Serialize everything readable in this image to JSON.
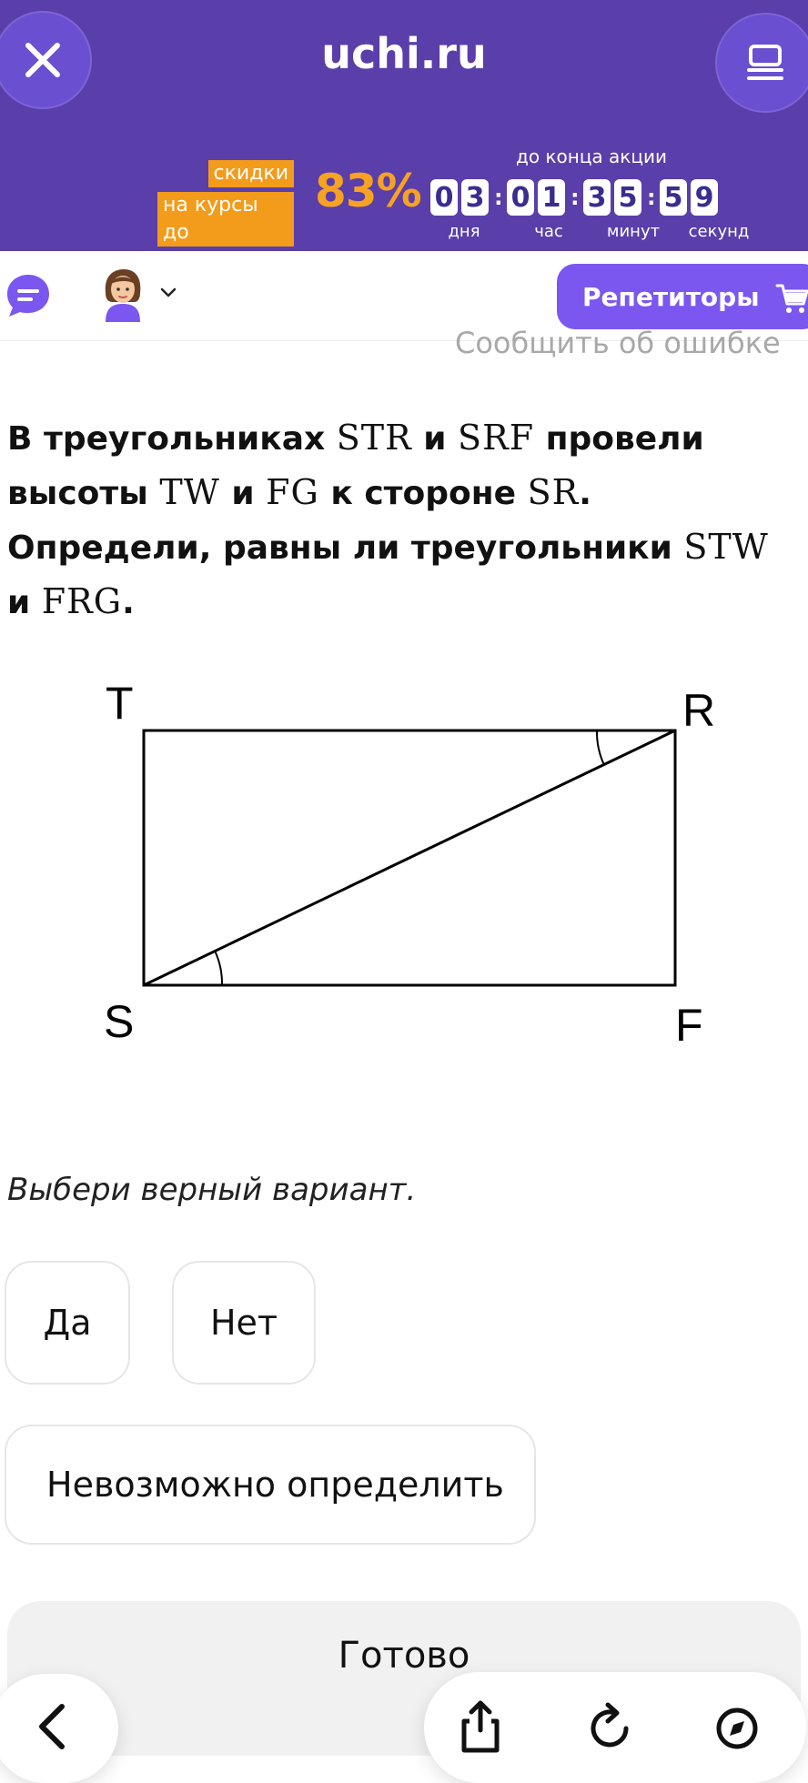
{
  "header": {
    "brand": "uchi.ru",
    "promo": {
      "tag_line1": "скидки",
      "tag_line2": "на курсы до",
      "percent": "83%",
      "until_label": "до конца акции",
      "countdown": {
        "days": [
          "0",
          "3"
        ],
        "hours": [
          "0",
          "1"
        ],
        "minutes": [
          "3",
          "5"
        ],
        "seconds": [
          "5",
          "9"
        ]
      },
      "units": {
        "days": "дня",
        "hours": "час",
        "minutes": "минут",
        "seconds": "секунд"
      }
    }
  },
  "toolbar": {
    "tutors_label": "Репетиторы"
  },
  "content": {
    "report_link": "Сообщить об ошибке",
    "question": {
      "p1": "В треугольниках ",
      "m1": "STR",
      "p2": " и ",
      "m2": "SRF",
      "p3": " провели высоты ",
      "m3": "TW",
      "p4": " и ",
      "m4": "FG",
      "p5": " к стороне ",
      "m5": "SR",
      "p6": ". Определи, равны ли треугольники ",
      "m6": "STW",
      "p7": " и ",
      "m7": "FRG",
      "p8": "."
    },
    "diagram_labels": {
      "T": "T",
      "R": "R",
      "S": "S",
      "F": "F"
    },
    "prompt": "Выбери верный вариант.",
    "options": {
      "yes": "Да",
      "no": "Нет",
      "unknown": "Невозможно определить"
    },
    "done": "Готово"
  },
  "icons": [
    "close-icon",
    "menu-icon",
    "chat-icon",
    "avatar",
    "chevron-down-icon",
    "cart-icon",
    "back-icon",
    "share-icon",
    "reload-icon",
    "compass-icon"
  ],
  "colors": {
    "header_bg": "#5a3ea9",
    "accent": "#7b57f0",
    "promo": "#f39b1b"
  }
}
